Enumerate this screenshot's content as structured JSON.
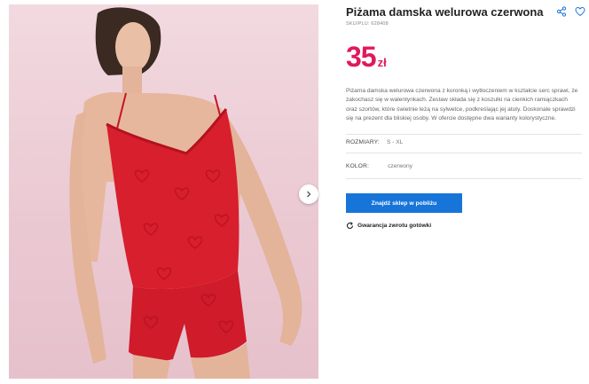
{
  "product": {
    "title": "Piżama damska welurowa czerwona",
    "sku": "SKU/PLU: 628408",
    "price_value": "35",
    "price_currency": "zł",
    "description": "Piżama damska welurowa czerwona z koronką i wytłoczeniem w kształcie serc sprawi, że zakochasz się w walentynkach. Zestaw składa się z koszulki na cienkich ramiączkach oraz szortów, które świetnie leżą na sylwetce, podkreślając jej atuty. Doskonale sprawdzi się na prezent dla bliskiej osoby. W ofercie dostępne dwa warianty kolorystyczne."
  },
  "attributes": {
    "sizes_label": "ROZMIARY:",
    "sizes_value": "S - XL",
    "color_label": "KOLOR:",
    "color_value": "czerwony"
  },
  "actions": {
    "find_store": "Znajdź sklep w pobliżu",
    "guarantee": "Gwarancja zwrotu gotówki"
  },
  "icons": {
    "share": "share-icon",
    "favorite": "heart-icon",
    "next": "chevron-right-icon",
    "return": "refresh-icon"
  },
  "colors": {
    "price": "#e0195c",
    "button": "#1775d9",
    "photo_background": "#eac8d2",
    "garment": "#d81f2e"
  }
}
